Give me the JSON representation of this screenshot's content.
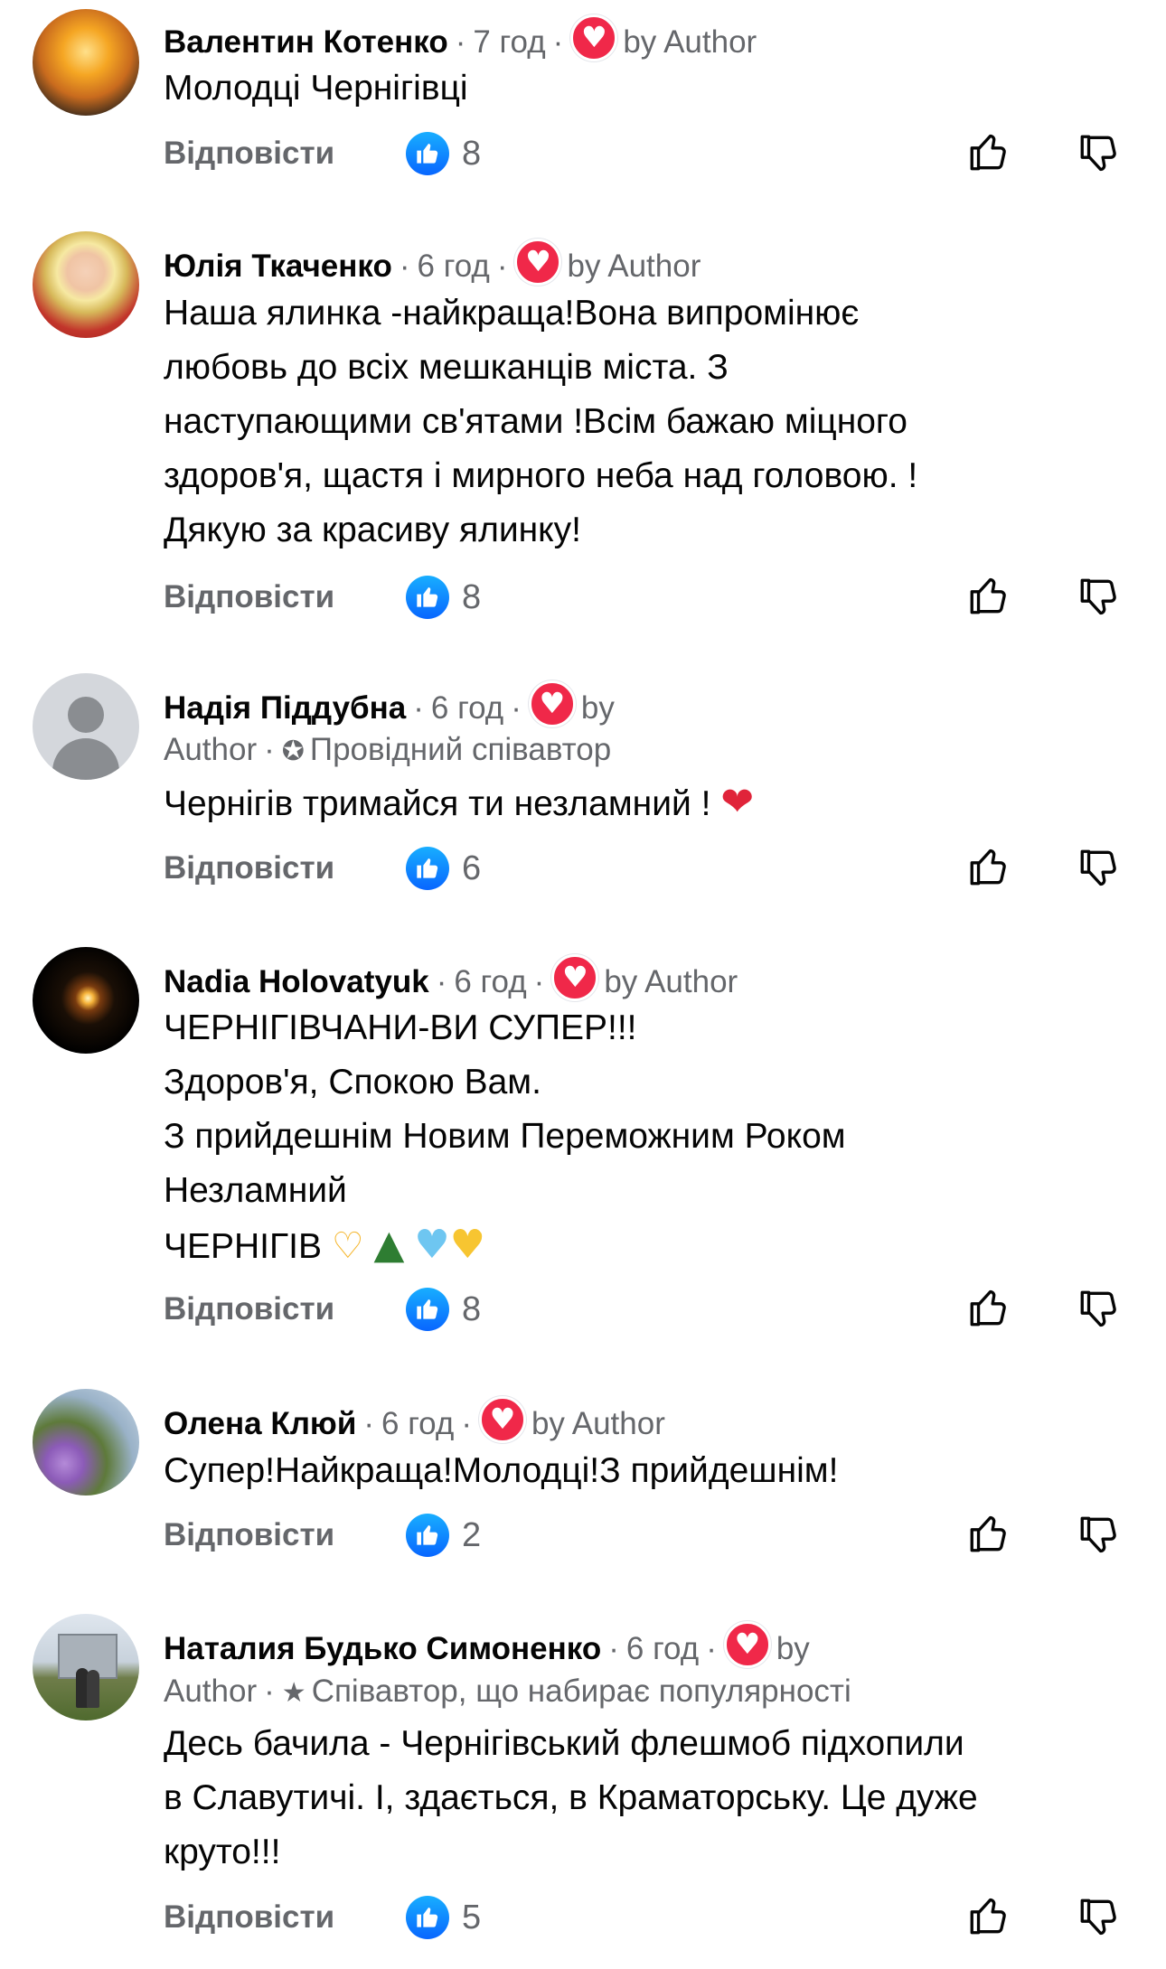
{
  "reply_label": "Відповісти",
  "sep": "·",
  "by_author": "by Author",
  "by": "by",
  "author": "Author",
  "comments": [
    {
      "name": "Валентин Котенко",
      "time": "7 год",
      "lines": [
        "Молодці Чернігівці"
      ],
      "likes": "8"
    },
    {
      "name": "Юлія Ткаченко",
      "time": "6 год",
      "lines": [
        "Наша ялинка -найкраща!Вона випромінює",
        "любовь до всіх мешканців міста. З",
        "наступающими св'ятами !Всім бажаю міцного",
        "здоров'я, щастя і мирного неба над головою. !",
        "Дякую за красиву ялинку!"
      ],
      "likes": "8"
    },
    {
      "name": "Надія Піддубна",
      "time": "6 год",
      "badge": "Провідний співавтор",
      "lines": [
        "Чернігів тримайся ти незламний ! "
      ],
      "likes": "6"
    },
    {
      "name": "Nadia Holovatyuk",
      "time": "6 год",
      "lines": [
        "ЧЕРНІГІВЧАНИ-ВИ СУПЕР!!!",
        "Здоров'я, Спокою Вам.",
        "З прийдешнім Новим Переможним Роком",
        "Незламний",
        "ЧЕРНІГІВ "
      ],
      "likes": "8"
    },
    {
      "name": "Олена Клюй",
      "time": "6 год",
      "lines": [
        "Супер!Найкраща!Молодці!З прийдешнім!"
      ],
      "likes": "2"
    },
    {
      "name": "Наталия Будько Симоненко",
      "time": "6 год",
      "badge": "Співавтор, що набирає популярності",
      "lines": [
        "Десь бачила - Чернігівський флешмоб підхопили",
        "в Славутичі. І, здається, в Краматорську. Це дуже",
        "круто!!!"
      ],
      "likes": "5"
    }
  ],
  "colors": {
    "accent_blue": "#0866ff",
    "heart_red": "#f02849",
    "secondary_text": "#65676b"
  },
  "icons": [
    "heart-icon",
    "like-icon",
    "thumbs-up-outline-icon",
    "thumbs-down-outline-icon",
    "badge-ribbon-icon",
    "star-icon",
    "red-heart-emoji",
    "heart-hands-emoji",
    "christmas-tree-emoji",
    "blue-heart-emoji",
    "yellow-heart-emoji"
  ]
}
